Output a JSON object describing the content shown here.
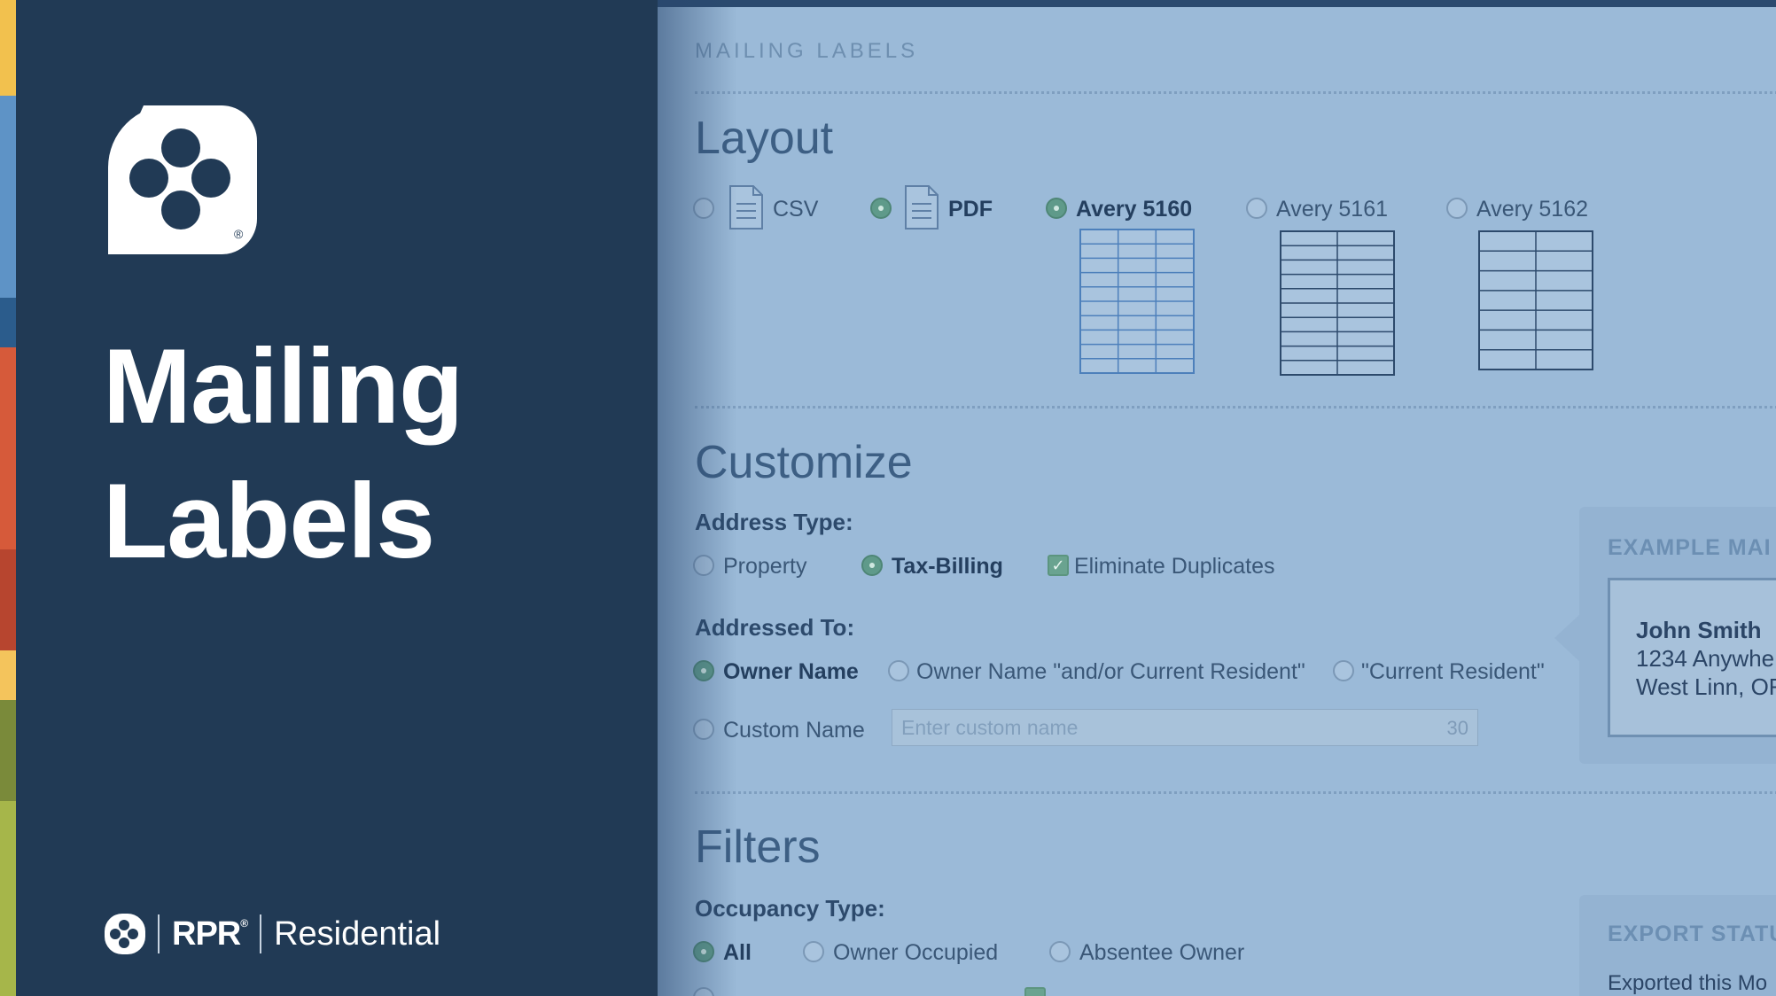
{
  "brand": {
    "title_line1": "Mailing",
    "title_line2": "Labels",
    "rpr": "RPR",
    "registered": "®",
    "division": "Residential"
  },
  "colors": {
    "panel": "#213a55",
    "app_bg": "#9bbad8",
    "stripes": [
      "#f2c14e",
      "#5e93c6",
      "#2b5c8c",
      "#d65a3a",
      "#b7452f",
      "#9b3b2c",
      "#f4c45c",
      "#7a8a3a",
      "#a6b64a"
    ]
  },
  "app": {
    "header": "MAILING LABELS",
    "layout": {
      "title": "Layout",
      "options": [
        {
          "label": "CSV",
          "selected": false,
          "icon": "document-icon"
        },
        {
          "label": "PDF",
          "selected": true,
          "icon": "document-icon"
        },
        {
          "label": "Avery 5160",
          "selected": true
        },
        {
          "label": "Avery 5161",
          "selected": false
        },
        {
          "label": "Avery 5162",
          "selected": false
        }
      ]
    },
    "customize": {
      "title": "Customize",
      "address_type_label": "Address Type:",
      "address_types": [
        {
          "label": "Property",
          "selected": false
        },
        {
          "label": "Tax-Billing",
          "selected": true
        }
      ],
      "eliminate_duplicates": {
        "label": "Eliminate Duplicates",
        "checked": true
      },
      "addressed_to_label": "Addressed To:",
      "addressed_to": [
        {
          "label": "Owner Name",
          "selected": true
        },
        {
          "label": "Owner Name \"and/or Current Resident\"",
          "selected": false
        },
        {
          "label": "\"Current Resident\"",
          "selected": false
        },
        {
          "label": "Custom Name",
          "selected": false
        }
      ],
      "custom_name_placeholder": "Enter custom name",
      "custom_name_counter": "30"
    },
    "example": {
      "title": "EXAMPLE MAI",
      "name": "John Smith",
      "line1": "1234 Anywhe",
      "line2": "West Linn, OF"
    },
    "filters": {
      "title": "Filters",
      "occupancy_label": "Occupancy Type:",
      "occupancy": [
        {
          "label": "All",
          "selected": true
        },
        {
          "label": "Owner Occupied",
          "selected": false
        },
        {
          "label": "Absentee Owner",
          "selected": false
        }
      ]
    },
    "export": {
      "title": "EXPORT STATU",
      "text": "Exported this Mo"
    }
  }
}
